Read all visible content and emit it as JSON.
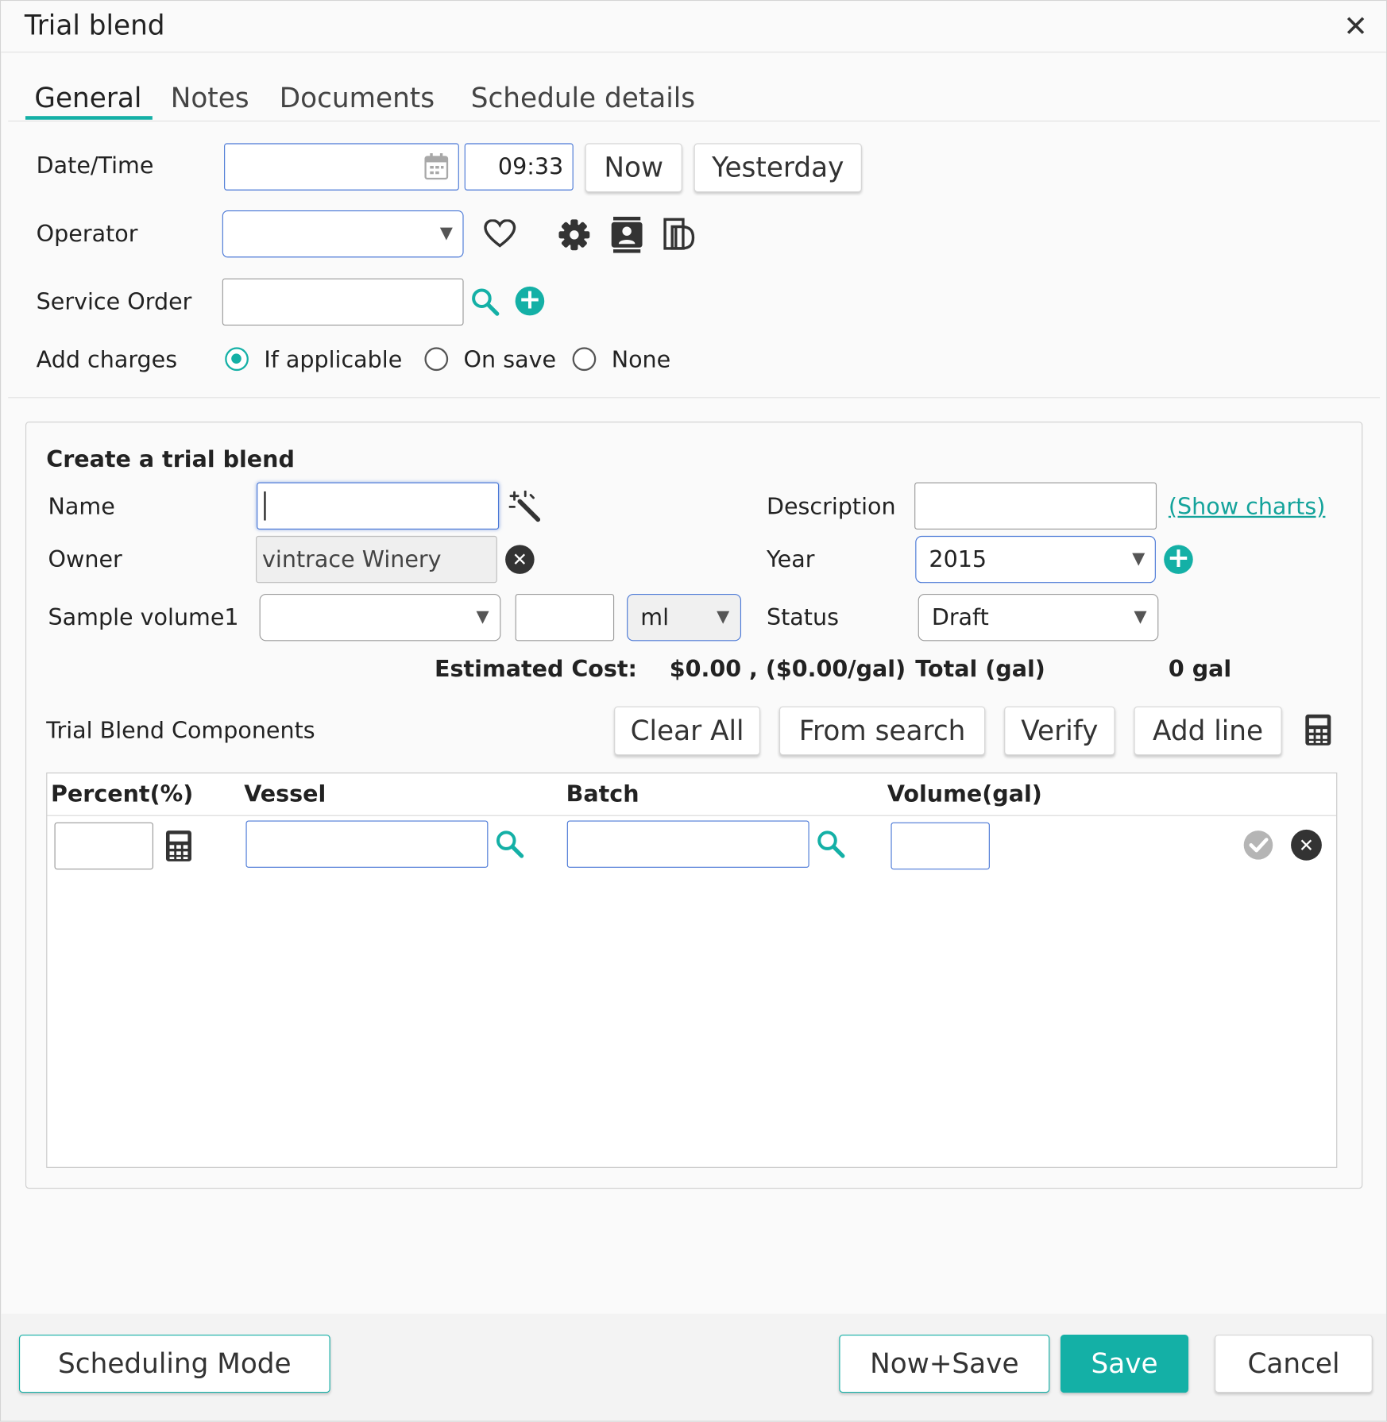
{
  "window": {
    "title": "Trial blend"
  },
  "tabs": [
    {
      "label": "General"
    },
    {
      "label": "Notes"
    },
    {
      "label": "Documents"
    },
    {
      "label": "Schedule details"
    }
  ],
  "general": {
    "datetime_label": "Date/Time",
    "time_value": "09:33",
    "now_button": "Now",
    "yesterday_button": "Yesterday",
    "operator_label": "Operator",
    "service_order_label": "Service Order",
    "add_charges_label": "Add charges",
    "add_charges_options": [
      "If applicable",
      "On save",
      "None"
    ],
    "add_charges_selected": "If applicable"
  },
  "trial_blend": {
    "heading": "Create a trial blend",
    "name_label": "Name",
    "owner_label": "Owner",
    "owner_value": "vintrace Winery",
    "sample_volume_label": "Sample volume1",
    "sample_unit": "ml",
    "description_label": "Description",
    "show_charts_link": "(Show charts)",
    "year_label": "Year",
    "year_value": "2015",
    "status_label": "Status",
    "status_value": "Draft",
    "estimated_cost_label": "Estimated Cost:",
    "estimated_cost_value": "$0.00 , ($0.00/gal)",
    "total_label": "Total (gal)",
    "total_value": "0 gal",
    "components_label": "Trial Blend Components",
    "clear_all_button": "Clear All",
    "from_search_button": "From search",
    "verify_button": "Verify",
    "add_line_button": "Add line",
    "columns": [
      "Percent(%)",
      "Vessel",
      "Batch",
      "Volume(gal)"
    ]
  },
  "footer": {
    "scheduling_mode_button": "Scheduling Mode",
    "now_save_button": "Now+Save",
    "save_button": "Save",
    "cancel_button": "Cancel"
  },
  "colors": {
    "accent": "#14b0a6",
    "input_border": "#4a78d6"
  }
}
